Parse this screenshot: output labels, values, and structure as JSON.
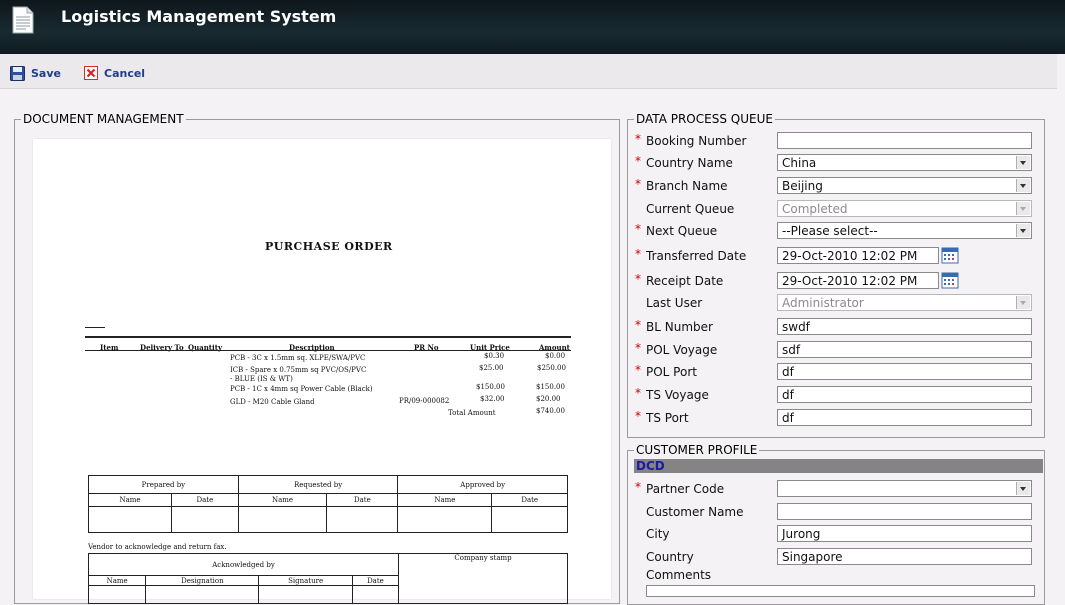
{
  "app": {
    "title": "Logistics Management System",
    "icon": "document-icon"
  },
  "toolbar": {
    "save_label": "Save",
    "cancel_label": "Cancel"
  },
  "doc_panel": {
    "legend": "DOCUMENT MANAGEMENT",
    "scan": {
      "title": "PURCHASE ORDER",
      "columns": [
        "Item",
        "Delivery To",
        "Quantity",
        "Description",
        "PR No",
        "Unit Price",
        "Amount"
      ],
      "rows": [
        {
          "description": "PCB - 3C x 1.5mm sq. XLPE/SWA/PVC",
          "pr": "",
          "unit": "$0.30",
          "amount": "$0.00"
        },
        {
          "description": "ICB - Spare x 0.75mm sq PVC/OS/PVC",
          "pr": "",
          "unit": "$25.00",
          "amount": "$250.00"
        },
        {
          "description": "- BLUE (IS & WT)",
          "pr": "",
          "unit": "",
          "amount": ""
        },
        {
          "description": "PCB - 1C x 4mm sq Power Cable (Black)",
          "pr": "",
          "unit": "$150.00",
          "amount": "$150.00"
        },
        {
          "description": "GLD - M20 Cable Gland",
          "pr": "PR/09-000082",
          "unit": "$32.00",
          "amount": "$20.00"
        }
      ],
      "total_label": "Total Amount",
      "total_value": "$740.00",
      "sign_headers": [
        "Prepared by",
        "Requested by",
        "Approved by"
      ],
      "sign_sub": [
        "Name",
        "Date",
        "Name",
        "Date",
        "Name",
        "Date"
      ],
      "vendor_note": "Vendor to acknowledge and return fax.",
      "ack_label": "Acknowledged by",
      "stamp_label": "Company stamp",
      "ack_sub": [
        "Name",
        "Designation",
        "Signature",
        "Date"
      ]
    }
  },
  "queue": {
    "legend": "DATA PROCESS QUEUE",
    "fields": [
      {
        "label": "Booking Number",
        "required": "*",
        "value": ""
      },
      {
        "label": "Country Name",
        "required": "*",
        "value": "China"
      },
      {
        "label": "Branch Name",
        "required": "*",
        "value": "Beijing"
      },
      {
        "label": "Current Queue",
        "required": "",
        "value": "Completed"
      },
      {
        "label": "Next Queue",
        "required": "*",
        "value": "--Please select--"
      },
      {
        "label": "Transferred Date",
        "required": "*",
        "value": "29-Oct-2010 12:02 PM"
      },
      {
        "label": "Receipt Date",
        "required": "*",
        "value": "29-Oct-2010 12:02 PM"
      },
      {
        "label": "Last User",
        "required": "",
        "value": "Administrator"
      },
      {
        "label": "BL Number",
        "required": "*",
        "value": "swdf"
      },
      {
        "label": "POL Voyage",
        "required": "*",
        "value": "sdf"
      },
      {
        "label": "POL Port",
        "required": "*",
        "value": "df"
      },
      {
        "label": "TS Voyage",
        "required": "*",
        "value": "df"
      },
      {
        "label": "TS Port",
        "required": "*",
        "value": "df"
      }
    ]
  },
  "customer": {
    "legend": "CUSTOMER PROFILE",
    "code_bar": "DCD",
    "fields": [
      {
        "label": "Partner Code",
        "required": "*",
        "value": ""
      },
      {
        "label": "Customer Name",
        "required": "",
        "value": ""
      },
      {
        "label": "City",
        "required": "",
        "value": "Jurong"
      },
      {
        "label": "Country",
        "required": "",
        "value": "Singapore"
      },
      {
        "label": "Comments",
        "required": "",
        "value": ""
      }
    ]
  },
  "colors": {
    "titlebar": "#16252b",
    "link": "#1c3f8c",
    "required": "#cc0000",
    "code_bar": "#848484"
  }
}
